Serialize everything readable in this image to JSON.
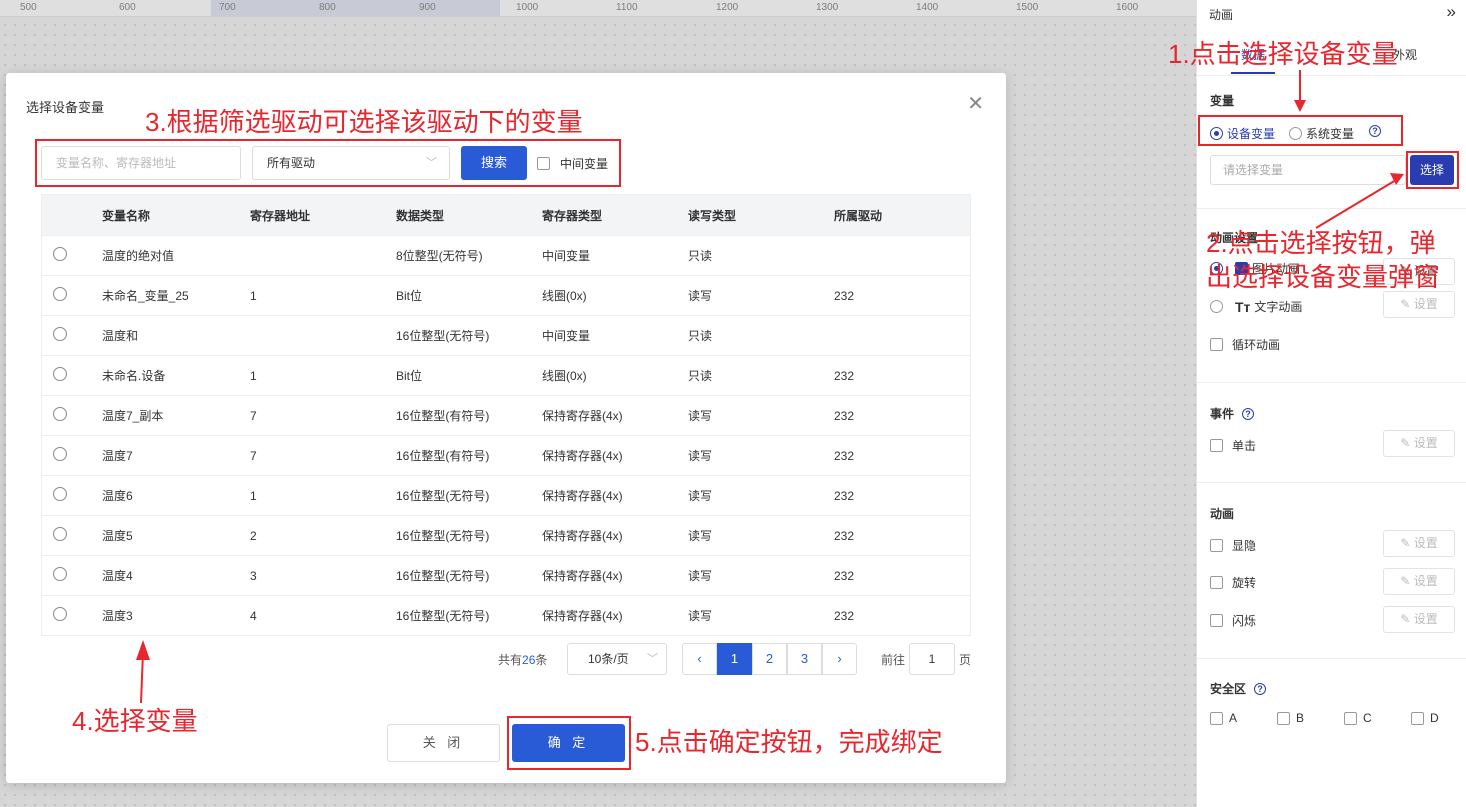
{
  "ruler": {
    "ticks": [
      "500",
      "600",
      "700",
      "800",
      "900",
      "1000",
      "1100",
      "1200",
      "1300",
      "1400",
      "1500",
      "1600"
    ]
  },
  "panel": {
    "header": "动画",
    "tabs": [
      "数据",
      "外观"
    ],
    "variable_title": "变量",
    "var_options": [
      "设备变量",
      "系统变量"
    ],
    "var_placeholder": "请选择变量",
    "select_label": "选择",
    "anim_settings_title": "动画设置",
    "anim_options": [
      "图片动画",
      "文字动画"
    ],
    "loop_label": "循环动画",
    "set_label": "设置",
    "event_title": "事件",
    "click_label": "单击",
    "animation_title": "动画",
    "anim_checks": [
      "显隐",
      "旋转",
      "闪烁"
    ],
    "safe_title": "安全区",
    "safe_items": [
      "A",
      "B",
      "C",
      "D"
    ]
  },
  "dialog": {
    "title": "选择设备变量",
    "search_placeholder": "变量名称、寄存器地址",
    "drive_value": "所有驱动",
    "search_button": "搜索",
    "mid_var_label": "中间变量",
    "columns": [
      "变量名称",
      "寄存器地址",
      "数据类型",
      "寄存器类型",
      "读写类型",
      "所属驱动"
    ],
    "rows": [
      [
        "温度的绝对值",
        "",
        "8位整型(无符号)",
        "中间变量",
        "只读",
        ""
      ],
      [
        "未命名_变量_25",
        "1",
        "Bit位",
        "线圈(0x)",
        "读写",
        "232"
      ],
      [
        "温度和",
        "",
        "16位整型(无符号)",
        "中间变量",
        "只读",
        ""
      ],
      [
        "未命名.设备",
        "1",
        "Bit位",
        "线圈(0x)",
        "只读",
        "232"
      ],
      [
        "温度7_副本",
        "7",
        "16位整型(有符号)",
        "保持寄存器(4x)",
        "读写",
        "232"
      ],
      [
        "温度7",
        "7",
        "16位整型(有符号)",
        "保持寄存器(4x)",
        "读写",
        "232"
      ],
      [
        "温度6",
        "1",
        "16位整型(无符号)",
        "保持寄存器(4x)",
        "读写",
        "232"
      ],
      [
        "温度5",
        "2",
        "16位整型(无符号)",
        "保持寄存器(4x)",
        "读写",
        "232"
      ],
      [
        "温度4",
        "3",
        "16位整型(无符号)",
        "保持寄存器(4x)",
        "读写",
        "232"
      ],
      [
        "温度3",
        "4",
        "16位整型(无符号)",
        "保持寄存器(4x)",
        "读写",
        "232"
      ]
    ],
    "pager": {
      "total_prefix": "共有",
      "total": "26",
      "total_suffix": "条",
      "page_size": "10条/页",
      "prev": "‹",
      "pages": [
        "1",
        "2",
        "3"
      ],
      "current_page": 1,
      "next": "›",
      "goto_label": "前往",
      "goto_value": "1",
      "goto_unit": "页"
    },
    "close_button": "关 闭",
    "ok_button": "确 定"
  },
  "annotations": {
    "step1": "1.点击选择设备变量",
    "step2_line1": "2.点击选择按钮，弹",
    "step2_line2": "出选择设备变量弹窗",
    "step3": "3.根据筛选驱动可选择该驱动下的变量",
    "step4": "4.选择变量",
    "step5": "5.点击确定按钮，完成绑定"
  },
  "colors": {
    "accent": "#2a5bd7",
    "annotation": "#e8262e",
    "panel_accent": "#2a3cb0"
  }
}
